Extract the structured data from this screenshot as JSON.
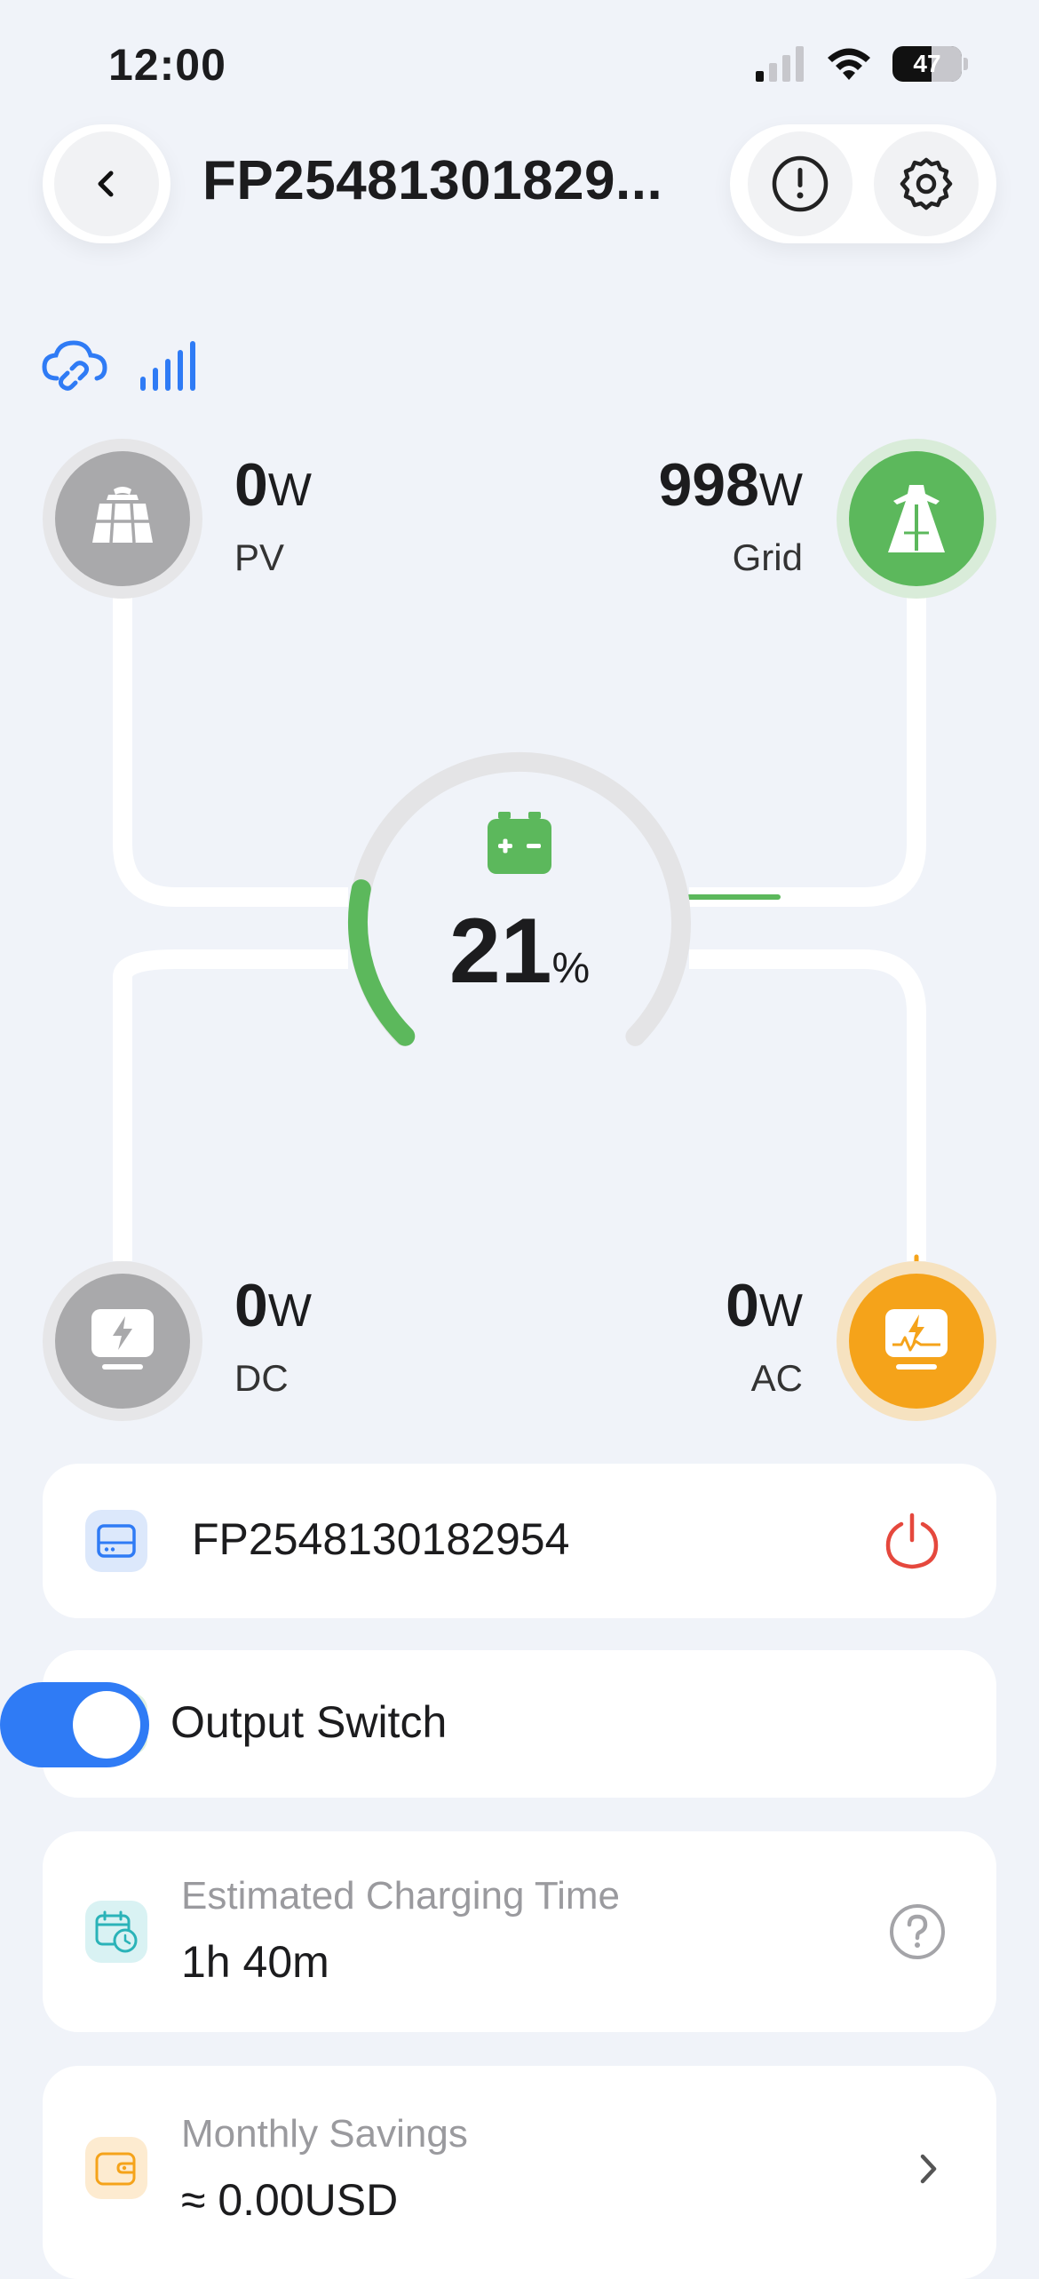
{
  "status_bar": {
    "time": "12:00",
    "battery": "47"
  },
  "header": {
    "title": "FP25481301829..."
  },
  "energy": {
    "pv": {
      "value": "0",
      "unit": "W",
      "label": "PV"
    },
    "grid": {
      "value": "998",
      "unit": "W",
      "label": "Grid"
    },
    "battery": {
      "percent": "21",
      "unit": "%",
      "level": 0.21
    },
    "dc": {
      "value": "0",
      "unit": "W",
      "label": "DC"
    },
    "ac": {
      "value": "0",
      "unit": "W",
      "label": "AC"
    }
  },
  "device_card": {
    "serial": "FP2548130182954"
  },
  "output_card": {
    "label": "Output Switch",
    "enabled": true
  },
  "charging_card": {
    "label": "Estimated Charging Time",
    "value": "1h 40m"
  },
  "savings_card": {
    "label": "Monthly Savings",
    "value": "≈ 0.00USD"
  },
  "colors": {
    "green": "#5cb85c",
    "orange": "#f5a31a",
    "blue": "#2f7bf5",
    "red": "#e5483d"
  }
}
